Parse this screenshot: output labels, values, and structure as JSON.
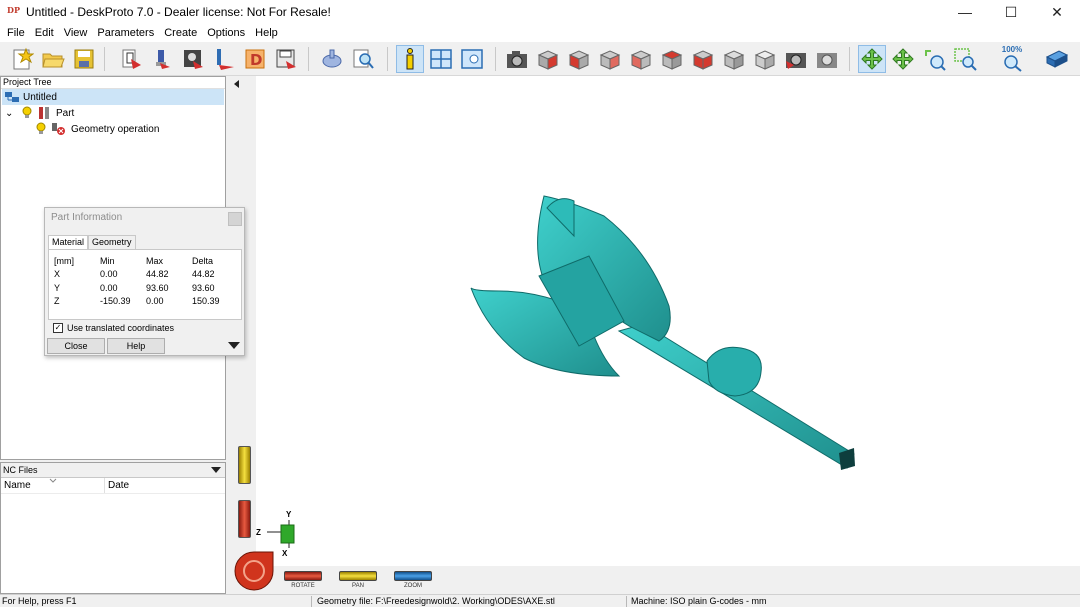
{
  "window": {
    "app_icon_text": "DP",
    "title": "Untitled - DeskProto 7.0 - Dealer license: Not For Resale!",
    "minimize_glyph": "—",
    "maximize_glyph": "☐",
    "close_glyph": "✕"
  },
  "menu": [
    "File",
    "Edit",
    "View",
    "Parameters",
    "Create",
    "Options",
    "Help"
  ],
  "toolbar": {
    "icons": [
      "new-project-icon",
      "open-project-icon",
      "save-project-icon",
      "new-part-icon",
      "machine-icon",
      "part-image-icon",
      "operation-icon",
      "drawing-icon",
      "save-nc-icon",
      "pointer-icon",
      "zoom-search-icon",
      "info-icon",
      "view-layout-icon",
      "view-window-icon",
      "camera-icon",
      "view-cube-1-icon",
      "view-cube-2-icon",
      "view-cube-3-icon",
      "view-cube-4-icon",
      "view-cube-5-icon",
      "view-cube-6-icon",
      "view-cube-7-icon",
      "view-cube-8-icon",
      "photo-icon",
      "photo-gray-icon",
      "rotate-icon",
      "pan-icon",
      "zoom-in-icon",
      "zoom-window-icon",
      "zoom-100-icon",
      "help-book-icon"
    ],
    "zoom_label": "100%"
  },
  "project_tree": {
    "title": "Project Tree",
    "items": [
      {
        "label": "Untitled",
        "selected": true
      },
      {
        "label": "Part",
        "expander": "⌄"
      },
      {
        "label": "Geometry operation"
      }
    ]
  },
  "nc_files": {
    "title": "NC Files",
    "columns": [
      "Name",
      "Date"
    ]
  },
  "part_info": {
    "title": "Part Information",
    "tabs": [
      "Material",
      "Geometry"
    ],
    "active_tab": "Material",
    "table": {
      "headers": [
        "[mm]",
        "Min",
        "Max",
        "Delta"
      ],
      "rows": [
        [
          "X",
          "0.00",
          "44.82",
          "44.82"
        ],
        [
          "Y",
          "0.00",
          "93.60",
          "93.60"
        ],
        [
          "Z",
          "-150.39",
          "0.00",
          "150.39"
        ]
      ]
    },
    "checkbox_label": "Use translated coordinates",
    "checkbox_checked": true,
    "close_label": "Close",
    "help_label": "Help"
  },
  "viewport": {
    "model_color": "#2bb3b1",
    "axis_labels": {
      "y": "Y",
      "z": "Z",
      "x": "X"
    },
    "controls": [
      "ROTATE",
      "PAN",
      "ZOOM"
    ]
  },
  "statusbar": {
    "help": "For Help, press F1",
    "geometry": "Geometry file: F:\\Freedesignwold\\2. Working\\ODES\\AXE.stl",
    "machine": "Machine: ISO plain G-codes - mm"
  }
}
